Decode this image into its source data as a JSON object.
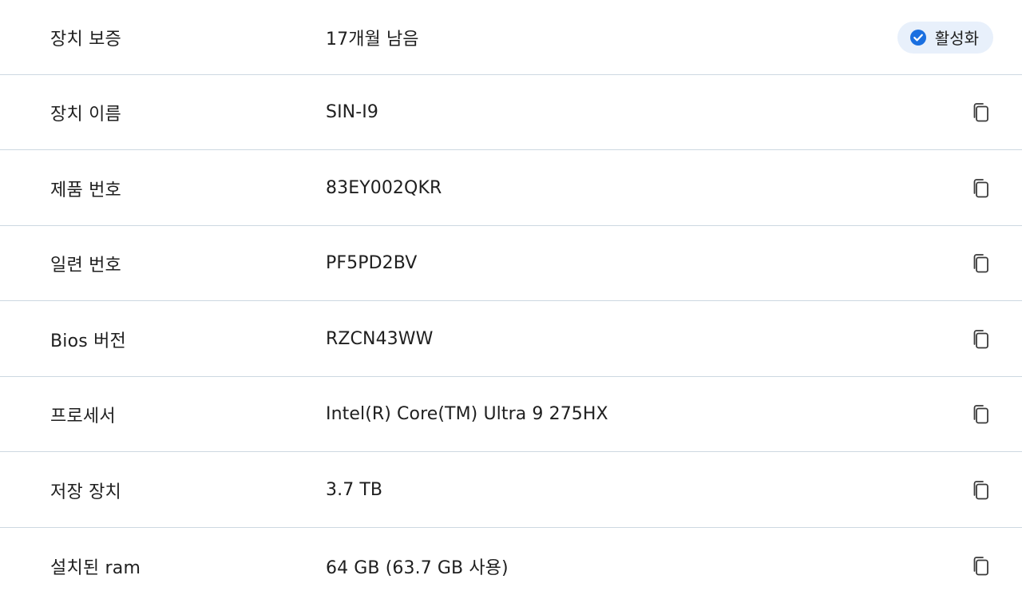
{
  "colors": {
    "accent": "#1a6fe0",
    "badge_bg": "#e8f0fb",
    "divider": "#cdd8e1",
    "text": "#1f1f1f"
  },
  "warranty": {
    "label": "장치 보증",
    "value": "17개월 남음",
    "status": "활성화",
    "status_icon": "check-circle-icon"
  },
  "rows": [
    {
      "label": "장치 이름",
      "value": "SIN-I9",
      "icon": "copy-icon"
    },
    {
      "label": "제품 번호",
      "value": "83EY002QKR",
      "icon": "copy-icon"
    },
    {
      "label": "일련 번호",
      "value": "PF5PD2BV",
      "icon": "copy-icon"
    },
    {
      "label": "Bios 버전",
      "value": "RZCN43WW",
      "icon": "copy-icon"
    },
    {
      "label": "프로세서",
      "value": "Intel(R) Core(TM) Ultra 9 275HX",
      "icon": "copy-icon"
    },
    {
      "label": "저장 장치",
      "value": "3.7 TB",
      "icon": "copy-icon"
    },
    {
      "label": "설치된 ram",
      "value": "64 GB (63.7 GB 사용)",
      "icon": "copy-icon"
    }
  ]
}
